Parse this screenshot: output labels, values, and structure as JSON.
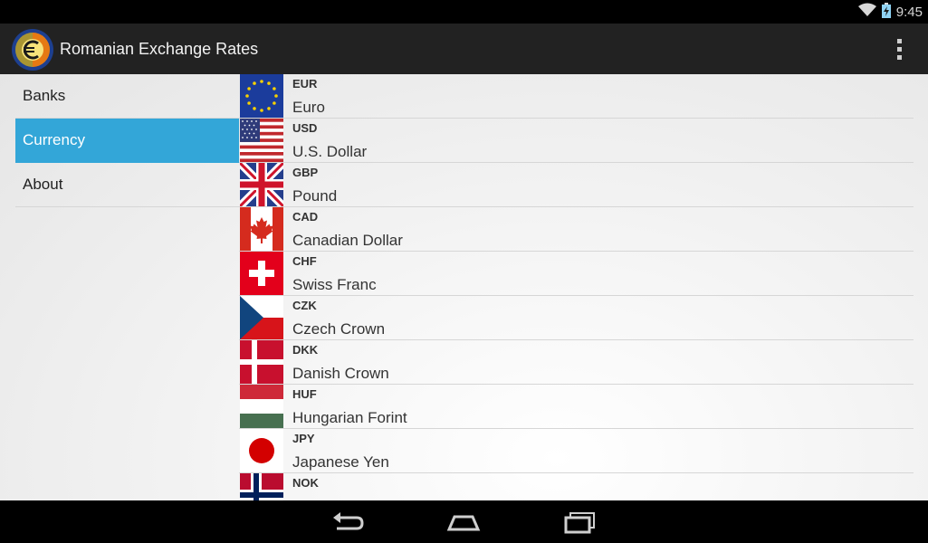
{
  "status_bar": {
    "time": "9:45"
  },
  "app": {
    "title": "Romanian Exchange Rates"
  },
  "sidebar": {
    "items": [
      {
        "label": "Banks"
      },
      {
        "label": "Currency"
      },
      {
        "label": "About"
      }
    ],
    "selected": "Currency"
  },
  "currencies": [
    {
      "code": "EUR",
      "name": "Euro",
      "flag": "eu-flag"
    },
    {
      "code": "USD",
      "name": "U.S. Dollar",
      "flag": "us-flag"
    },
    {
      "code": "GBP",
      "name": "Pound",
      "flag": "uk-flag"
    },
    {
      "code": "CAD",
      "name": "Canadian Dollar",
      "flag": "canada-flag"
    },
    {
      "code": "CHF",
      "name": "Swiss Franc",
      "flag": "switzerland-flag"
    },
    {
      "code": "CZK",
      "name": "Czech Crown",
      "flag": "czech-flag"
    },
    {
      "code": "DKK",
      "name": "Danish Crown",
      "flag": "denmark-flag"
    },
    {
      "code": "HUF",
      "name": "Hungarian Forint",
      "flag": "hungary-flag"
    },
    {
      "code": "JPY",
      "name": "Japanese Yen",
      "flag": "japan-flag"
    },
    {
      "code": "NOK",
      "name": "",
      "flag": "norway-flag"
    }
  ],
  "colors": {
    "accent": "#33a6d8",
    "action_bar": "#222222",
    "status_bar": "#000000"
  },
  "nav": {
    "buttons": [
      "back-icon",
      "home-icon",
      "recent-apps-icon"
    ]
  }
}
